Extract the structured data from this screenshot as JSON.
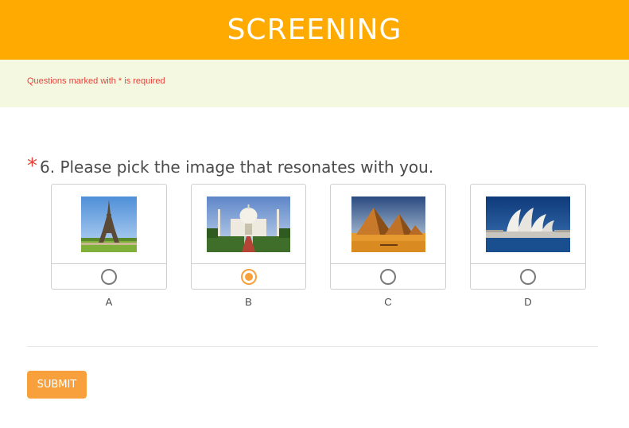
{
  "header": {
    "title": "SCREENING"
  },
  "notice": {
    "text": "Questions marked with * is required"
  },
  "question": {
    "required_marker": "*",
    "text": "6. Please pick the image that resonates with you.",
    "selected": "B",
    "choices": [
      {
        "label": "A",
        "image": "eiffel-tower-image"
      },
      {
        "label": "B",
        "image": "taj-mahal-image"
      },
      {
        "label": "C",
        "image": "pyramids-image"
      },
      {
        "label": "D",
        "image": "sydney-opera-house-image"
      }
    ]
  },
  "form": {
    "submit_label": "SUBMIT"
  },
  "colors": {
    "header": "#ffaa00",
    "notice_bg": "#f5f8e1",
    "accent": "#f7a03c",
    "required": "#e8423a"
  }
}
